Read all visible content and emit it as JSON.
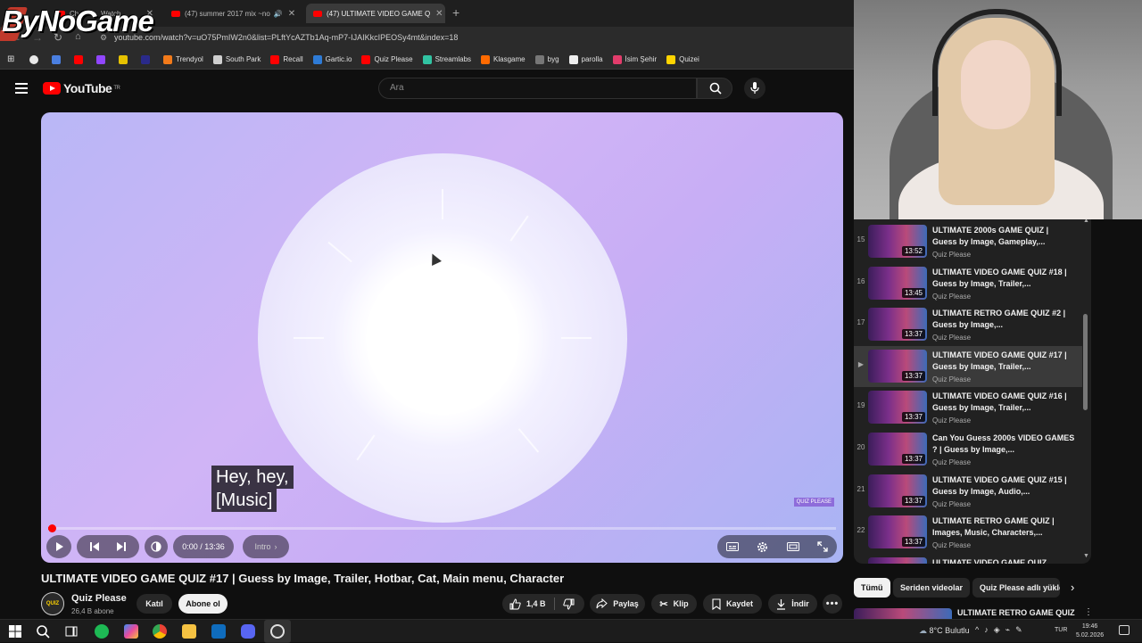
{
  "browser": {
    "tabs": [
      {
        "label": "Chan",
        "suffix": "Watch"
      },
      {
        "label": "(47) summer 2017 mix ~no"
      },
      {
        "label": "(47) ULTIMATE VIDEO GAME Q"
      }
    ],
    "url": "youtube.com/watch?v=uO75PmIW2n0&list=PLftYcAZTb1Aq-mP7-IJAIKkcIPEOSy4mt&index=18",
    "bookmarks": [
      {
        "label": "Trendyol",
        "color": "#f27a1a"
      },
      {
        "label": "South Park",
        "color": "#cfcfcf"
      },
      {
        "label": "Recall",
        "color": "#ff0000"
      },
      {
        "label": "Gartic.io",
        "color": "#2e7bd6"
      },
      {
        "label": "Quiz Please",
        "color": "#ff0000"
      },
      {
        "label": "Streamlabs",
        "color": "#31c3a2"
      },
      {
        "label": "Klasgame",
        "color": "#ff6a00"
      },
      {
        "label": "byg",
        "color": "#777777"
      },
      {
        "label": "parolla",
        "color": "#eeeeee"
      },
      {
        "label": "İsim Şehir",
        "color": "#e23c6b"
      },
      {
        "label": "Quizei",
        "color": "#ffd400"
      }
    ]
  },
  "watermark_logo": "ByNoGame",
  "header": {
    "logo_text": "YouTube",
    "logo_country": "TR",
    "search_placeholder": "Ara"
  },
  "player": {
    "subtitle_lines": [
      "Hey, hey,",
      "[Music]"
    ],
    "time": "0:00 / 13:36",
    "chapter": "Intro",
    "progress_fraction": 0.003,
    "watermark": "QUIZ PLEASE"
  },
  "video": {
    "title": "ULTIMATE VIDEO GAME QUIZ #17 | Guess by Image, Trailer, Hotbar, Cat, Main menu, Character",
    "channel": "Quiz Please",
    "channel_avatar_text": "QUIZ",
    "subscribers": "26,4 B abone",
    "join_label": "Katıl",
    "subscribe_label": "Abone ol",
    "likes": "1,4 B",
    "share_label": "Paylaş",
    "clip_label": "Klip",
    "save_label": "Kaydet",
    "download_label": "İndir"
  },
  "playlist": {
    "items": [
      {
        "index": "15",
        "title": "ULTIMATE 2000s GAME QUIZ | Guess by Image, Gameplay,...",
        "channel": "Quiz Please",
        "duration": "13:52"
      },
      {
        "index": "16",
        "title": "ULTIMATE VIDEO GAME QUIZ #18 | Guess by Image, Trailer,...",
        "channel": "Quiz Please",
        "duration": "13:45"
      },
      {
        "index": "17",
        "title": "ULTIMATE RETRO GAME QUIZ #2 | Guess by Image,...",
        "channel": "Quiz Please",
        "duration": "13:37"
      },
      {
        "index": "▶",
        "title": "ULTIMATE VIDEO GAME QUIZ #17 | Guess by Image, Trailer,...",
        "channel": "Quiz Please",
        "duration": "13:37",
        "current": true
      },
      {
        "index": "19",
        "title": "ULTIMATE VIDEO GAME QUIZ #16 | Guess by Image, Trailer,...",
        "channel": "Quiz Please",
        "duration": "13:37"
      },
      {
        "index": "20",
        "title": "Can You Guess 2000s VIDEO GAMES ? | Guess by Image,...",
        "channel": "Quiz Please",
        "duration": "13:37"
      },
      {
        "index": "21",
        "title": "ULTIMATE VIDEO GAME QUIZ #15 | Guess by Image, Audio,...",
        "channel": "Quiz Please",
        "duration": "13:37"
      },
      {
        "index": "22",
        "title": "ULTIMATE RETRO GAME QUIZ | Images, Music, Characters,...",
        "channel": "Quiz Please",
        "duration": "13:37"
      },
      {
        "index": "",
        "title": "ULTIMATE VIDEO GAME QUIZ",
        "channel": "",
        "duration": ""
      }
    ]
  },
  "chips": [
    "Tümü",
    "Seriden videolar",
    "Quiz Please adlı yükle"
  ],
  "next_video_title": "ULTIMATE RETRO GAME QUIZ",
  "taskbar": {
    "weather": "8°C  Bulutlu",
    "language": "TUR",
    "time": "19:46",
    "date": "5.02.2026"
  }
}
